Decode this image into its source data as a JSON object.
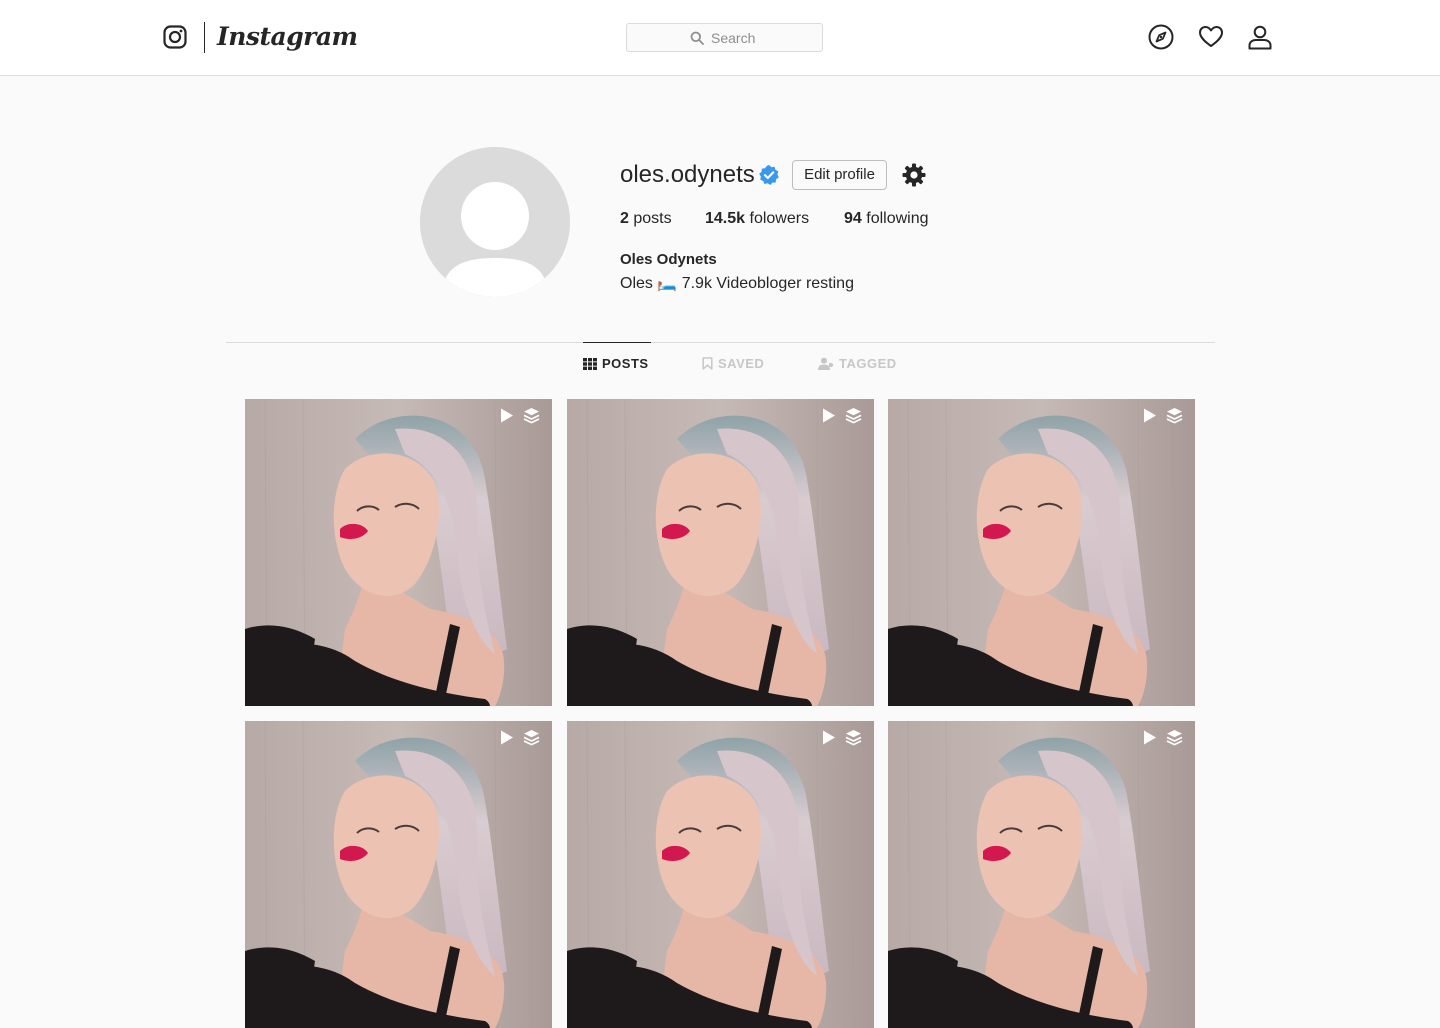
{
  "nav": {
    "brand": "Instagram",
    "search_placeholder": "Search",
    "icons": [
      "instagram-glyph-icon",
      "search-icon",
      "explore-compass-icon",
      "heart-icon",
      "profile-person-icon"
    ]
  },
  "profile": {
    "username": "oles.odynets",
    "verified": true,
    "edit_label": "Edit profile",
    "stats": {
      "posts_count": "2",
      "posts_label": "posts",
      "followers_count": "14.5k",
      "followers_label": "folowers",
      "following_count": "94",
      "following_label": "following"
    },
    "full_name": "Oles Odynets",
    "bio": "Oles 🛏️ 7.9k Videobloger resting"
  },
  "tabs": [
    {
      "label": "POSTS",
      "icon": "grid-icon",
      "active": true
    },
    {
      "label": "SAVED",
      "icon": "bookmark-icon",
      "active": false
    },
    {
      "label": "TAGGED",
      "icon": "tagged-person-icon",
      "active": false
    }
  ],
  "posts": [
    {
      "type": "video",
      "multiple": true
    },
    {
      "type": "video",
      "multiple": true
    },
    {
      "type": "video",
      "multiple": true
    },
    {
      "type": "video",
      "multiple": true
    },
    {
      "type": "video",
      "multiple": true
    },
    {
      "type": "video",
      "multiple": true
    }
  ],
  "colors": {
    "page_bg": "#fafafa",
    "nav_bg": "#ffffff",
    "border": "#dbdbdb",
    "text": "#262626",
    "muted": "#8e8e8e",
    "verified": "#3897f0",
    "tab_inactive": "#c7c7c7"
  }
}
